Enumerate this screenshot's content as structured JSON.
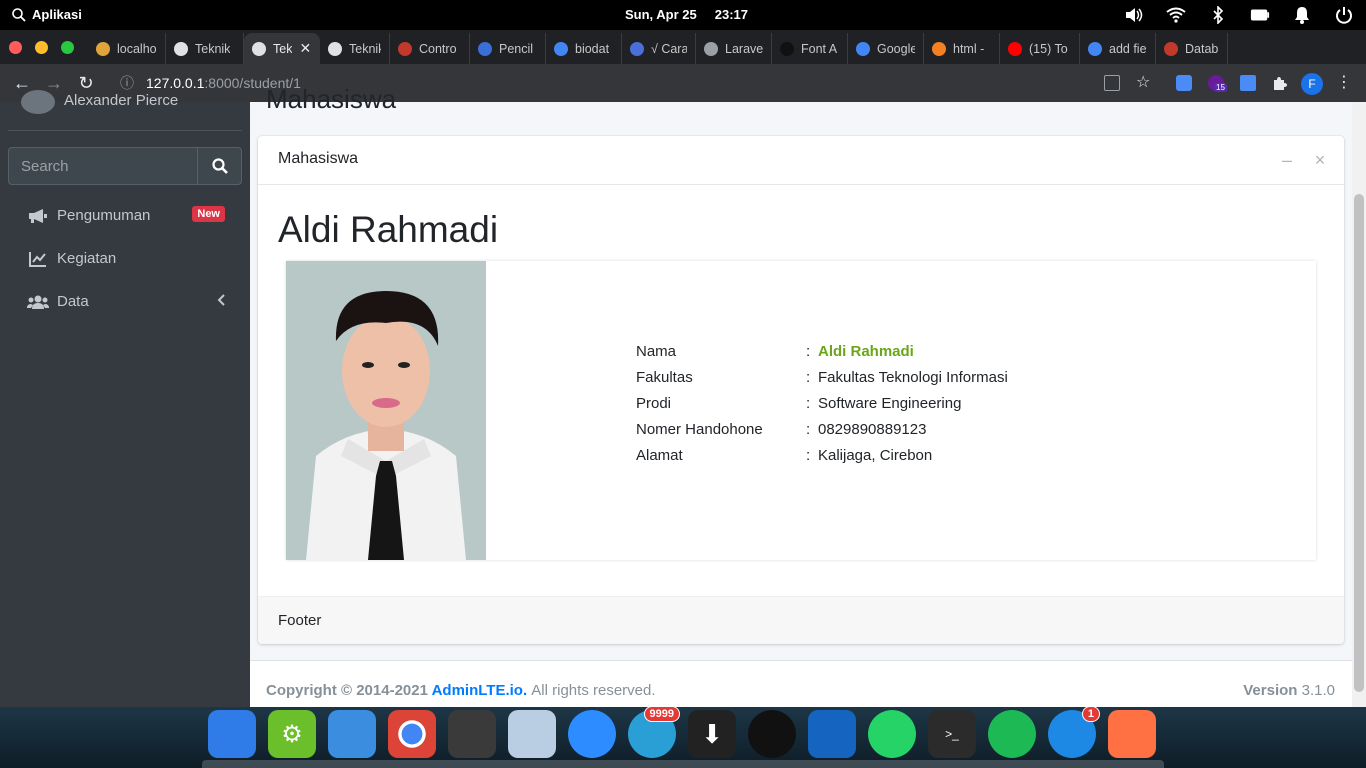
{
  "system": {
    "menu_label": "Aplikasi",
    "date": "Sun, Apr 25",
    "time": "23:17"
  },
  "browser": {
    "tabs": [
      {
        "label": "localho",
        "color": "#e0a43b"
      },
      {
        "label": "Teknik",
        "color": "#dfe1e5"
      },
      {
        "label": "Tek",
        "color": "#dfe1e5",
        "active": true
      },
      {
        "label": "Teknik",
        "color": "#dfe1e5"
      },
      {
        "label": "Contro",
        "color": "#c0392b"
      },
      {
        "label": "Pencil",
        "color": "#3b6fd8"
      },
      {
        "label": "biodat",
        "color": "#4285f4"
      },
      {
        "label": "√ Cara",
        "color": "#4a6fd8"
      },
      {
        "label": "Larave",
        "color": "#9aa0a6"
      },
      {
        "label": "Font A",
        "color": "#111111"
      },
      {
        "label": "Google",
        "color": "#4285f4"
      },
      {
        "label": "html -",
        "color": "#f48024"
      },
      {
        "label": "(15) To",
        "color": "#ff0000"
      },
      {
        "label": "add fie",
        "color": "#4285f4"
      },
      {
        "label": "Datab",
        "color": "#c0392b"
      }
    ],
    "url_host": "127.0.0.1",
    "url_path": ":8000/student/1",
    "profile_initial": "F",
    "ext_badge": "15"
  },
  "sidebar": {
    "user_name": "Alexander Pierce",
    "search_placeholder": "Search",
    "items": [
      {
        "label": "Pengumuman",
        "badge": "New"
      },
      {
        "label": "Kegiatan"
      },
      {
        "label": "Data"
      }
    ]
  },
  "content": {
    "page_title": "Mahasiswa",
    "card_title": "Mahasiswa",
    "student_name": "Aldi Rahmadi",
    "details": [
      {
        "key": "Nama",
        "value": "Aldi Rahmadi"
      },
      {
        "key": "Fakultas",
        "value": "Fakultas Teknologi Informasi"
      },
      {
        "key": "Prodi",
        "value": "Software Engineering"
      },
      {
        "key": "Nomer Handohone",
        "value": "0829890889123"
      },
      {
        "key": "Alamat",
        "value": "Kalijaga, Cirebon"
      }
    ],
    "colon": ":",
    "card_footer": "Footer"
  },
  "footer": {
    "copyright": "Copyright © 2014-2021",
    "brand": "AdminLTE.io.",
    "rights": "All rights reserved.",
    "version_label": "Version",
    "version": "3.1.0"
  },
  "dock": {
    "messenger_count": "9999",
    "update_count": "1"
  },
  "colors": {
    "accent": "#007bff",
    "highlight": "#6aa51a",
    "sidebar": "#343a40",
    "badge": "#dc3545"
  }
}
